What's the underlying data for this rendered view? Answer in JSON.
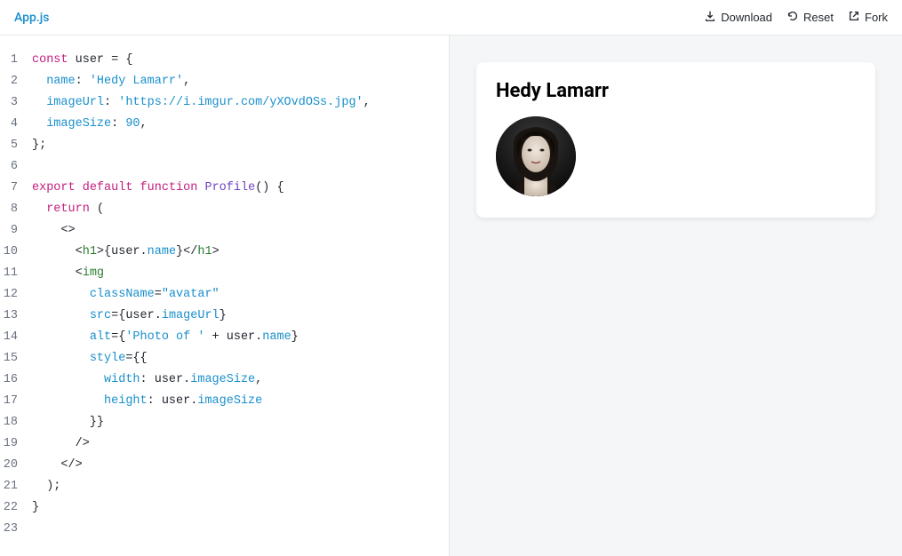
{
  "header": {
    "filename": "App.js",
    "download_label": "Download",
    "reset_label": "Reset",
    "fork_label": "Fork"
  },
  "editor": {
    "line_count": 23,
    "code_lines": [
      [
        {
          "t": "const",
          "c": "tok-keyword"
        },
        {
          "t": " user = {",
          "c": ""
        }
      ],
      [
        {
          "t": "  ",
          "c": ""
        },
        {
          "t": "name",
          "c": "tok-prop"
        },
        {
          "t": ": ",
          "c": ""
        },
        {
          "t": "'Hedy Lamarr'",
          "c": "tok-string"
        },
        {
          "t": ",",
          "c": ""
        }
      ],
      [
        {
          "t": "  ",
          "c": ""
        },
        {
          "t": "imageUrl",
          "c": "tok-prop"
        },
        {
          "t": ": ",
          "c": ""
        },
        {
          "t": "'https://i.imgur.com/yXOvdOSs.jpg'",
          "c": "tok-string"
        },
        {
          "t": ",",
          "c": ""
        }
      ],
      [
        {
          "t": "  ",
          "c": ""
        },
        {
          "t": "imageSize",
          "c": "tok-prop"
        },
        {
          "t": ": ",
          "c": ""
        },
        {
          "t": "90",
          "c": "tok-num"
        },
        {
          "t": ",",
          "c": ""
        }
      ],
      [
        {
          "t": "};",
          "c": ""
        }
      ],
      [
        {
          "t": "",
          "c": ""
        }
      ],
      [
        {
          "t": "export",
          "c": "tok-keyword"
        },
        {
          "t": " ",
          "c": ""
        },
        {
          "t": "default",
          "c": "tok-keyword"
        },
        {
          "t": " ",
          "c": ""
        },
        {
          "t": "function",
          "c": "tok-keyword"
        },
        {
          "t": " ",
          "c": ""
        },
        {
          "t": "Profile",
          "c": "tok-func"
        },
        {
          "t": "() {",
          "c": ""
        }
      ],
      [
        {
          "t": "  ",
          "c": ""
        },
        {
          "t": "return",
          "c": "tok-keyword"
        },
        {
          "t": " (",
          "c": ""
        }
      ],
      [
        {
          "t": "    <>",
          "c": ""
        }
      ],
      [
        {
          "t": "      <",
          "c": ""
        },
        {
          "t": "h1",
          "c": "tok-tag"
        },
        {
          "t": ">{user.",
          "c": ""
        },
        {
          "t": "name",
          "c": "tok-prop"
        },
        {
          "t": "}</",
          "c": ""
        },
        {
          "t": "h1",
          "c": "tok-tag"
        },
        {
          "t": ">",
          "c": ""
        }
      ],
      [
        {
          "t": "      <",
          "c": ""
        },
        {
          "t": "img",
          "c": "tok-tag"
        }
      ],
      [
        {
          "t": "        ",
          "c": ""
        },
        {
          "t": "className",
          "c": "tok-attr"
        },
        {
          "t": "=",
          "c": ""
        },
        {
          "t": "\"avatar\"",
          "c": "tok-string"
        }
      ],
      [
        {
          "t": "        ",
          "c": ""
        },
        {
          "t": "src",
          "c": "tok-attr"
        },
        {
          "t": "={user.",
          "c": ""
        },
        {
          "t": "imageUrl",
          "c": "tok-prop"
        },
        {
          "t": "}",
          "c": ""
        }
      ],
      [
        {
          "t": "        ",
          "c": ""
        },
        {
          "t": "alt",
          "c": "tok-attr"
        },
        {
          "t": "={",
          "c": ""
        },
        {
          "t": "'Photo of '",
          "c": "tok-string"
        },
        {
          "t": " + user.",
          "c": ""
        },
        {
          "t": "name",
          "c": "tok-prop"
        },
        {
          "t": "}",
          "c": ""
        }
      ],
      [
        {
          "t": "        ",
          "c": ""
        },
        {
          "t": "style",
          "c": "tok-attr"
        },
        {
          "t": "={{",
          "c": ""
        }
      ],
      [
        {
          "t": "          ",
          "c": ""
        },
        {
          "t": "width",
          "c": "tok-prop"
        },
        {
          "t": ": user.",
          "c": ""
        },
        {
          "t": "imageSize",
          "c": "tok-prop"
        },
        {
          "t": ",",
          "c": ""
        }
      ],
      [
        {
          "t": "          ",
          "c": ""
        },
        {
          "t": "height",
          "c": "tok-prop"
        },
        {
          "t": ": user.",
          "c": ""
        },
        {
          "t": "imageSize",
          "c": "tok-prop"
        }
      ],
      [
        {
          "t": "        }}",
          "c": ""
        }
      ],
      [
        {
          "t": "      />",
          "c": ""
        }
      ],
      [
        {
          "t": "    </>",
          "c": ""
        }
      ],
      [
        {
          "t": "  );",
          "c": ""
        }
      ],
      [
        {
          "t": "}",
          "c": ""
        }
      ],
      [
        {
          "t": "",
          "c": ""
        }
      ]
    ]
  },
  "preview": {
    "title": "Hedy Lamarr",
    "avatar_name": "Hedy Lamarr",
    "avatar_size": 90
  }
}
